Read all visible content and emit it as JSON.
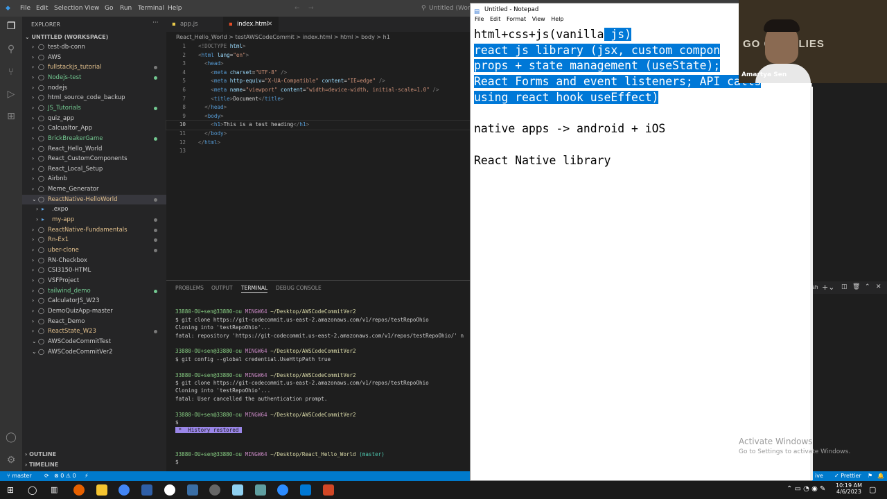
{
  "vscode": {
    "menu": [
      "File",
      "Edit",
      "Selection",
      "View",
      "Go",
      "Run",
      "Terminal",
      "Help"
    ],
    "window_title": "Untitled (Worksp",
    "explorer_title": "EXPLORER",
    "workspace_title": "UNTITLED (WORKSPACE)",
    "folders": [
      {
        "label": "test-db-conn",
        "color": "#cccccc",
        "dot": false
      },
      {
        "label": "AWS",
        "color": "#cccccc",
        "dot": false
      },
      {
        "label": "fullstackjs_tutorial",
        "color": "#e2c08d",
        "dot": true
      },
      {
        "label": "Nodejs-test",
        "color": "#73c991",
        "dot": true
      },
      {
        "label": "nodejs",
        "color": "#cccccc",
        "dot": false
      },
      {
        "label": "html_source_code_backup",
        "color": "#cccccc",
        "dot": false
      },
      {
        "label": "JS_Tutorials",
        "color": "#73c991",
        "dot": true
      },
      {
        "label": "quiz_app",
        "color": "#cccccc",
        "dot": false
      },
      {
        "label": "Calcualtor_App",
        "color": "#cccccc",
        "dot": false
      },
      {
        "label": "BrickBreakerGame",
        "color": "#73c991",
        "dot": true
      },
      {
        "label": "React_Hello_World",
        "color": "#cccccc",
        "dot": false
      },
      {
        "label": "React_CustomComponents",
        "color": "#cccccc",
        "dot": false
      },
      {
        "label": "React_Local_Setup",
        "color": "#cccccc",
        "dot": false
      },
      {
        "label": "Airbnb",
        "color": "#cccccc",
        "dot": false
      },
      {
        "label": "Meme_Generator",
        "color": "#cccccc",
        "dot": false
      },
      {
        "label": "ReactNative-HelloWorld",
        "color": "#e2c08d",
        "dot": true,
        "open": true,
        "selected": true
      },
      {
        "label": ".expo",
        "color": "#cccccc",
        "dot": false,
        "child": true
      },
      {
        "label": "my-app",
        "color": "#e2c08d",
        "dot": true,
        "child": true
      },
      {
        "label": "ReactNative-Fundamentals",
        "color": "#e2c08d",
        "dot": true
      },
      {
        "label": "Rn-Ex1",
        "color": "#e2c08d",
        "dot": true
      },
      {
        "label": "uber-clone",
        "color": "#e2c08d",
        "dot": true
      },
      {
        "label": "RN-Checkbox",
        "color": "#cccccc",
        "dot": false
      },
      {
        "label": "CSI3150-HTML",
        "color": "#cccccc",
        "dot": false
      },
      {
        "label": "VSFProject",
        "color": "#cccccc",
        "dot": false
      },
      {
        "label": "tailwind_demo",
        "color": "#73c991",
        "dot": true
      },
      {
        "label": "CalculatorJS_W23",
        "color": "#cccccc",
        "dot": false
      },
      {
        "label": "DemoQuizApp-master",
        "color": "#cccccc",
        "dot": false
      },
      {
        "label": "React_Demo",
        "color": "#cccccc",
        "dot": false
      },
      {
        "label": "ReactState_W23",
        "color": "#e2c08d",
        "dot": true
      },
      {
        "label": "AWSCodeCommitTest",
        "color": "#cccccc",
        "dot": false,
        "open": true
      },
      {
        "label": "AWSCodeCommitVer2",
        "color": "#cccccc",
        "dot": false,
        "open": true
      }
    ],
    "outline_label": "OUTLINE",
    "timeline_label": "TIMELINE",
    "tabs": [
      {
        "label": "app.js"
      },
      {
        "label": "index.html",
        "active": true
      }
    ],
    "breadcrumb": "React_Hello_World  >  testAWSCodeCommit  >  index.html  >  html  >  body  >  h1",
    "code_lines": [
      {
        "n": "1",
        "html": "<span style='color:#808080'>&lt;!DOCTYPE </span><span style='color:#9cdcfe'>html</span><span style='color:#808080'>&gt;</span>"
      },
      {
        "n": "2",
        "html": "<span style='color:#808080'>&lt;</span><span style='color:#569cd6'>html</span> <span style='color:#9cdcfe'>lang</span>=<span style='color:#ce9178'>\"en\"</span><span style='color:#808080'>&gt;</span>"
      },
      {
        "n": "3",
        "html": "  <span style='color:#808080'>&lt;</span><span style='color:#569cd6'>head</span><span style='color:#808080'>&gt;</span>"
      },
      {
        "n": "4",
        "html": "    <span style='color:#808080'>&lt;</span><span style='color:#569cd6'>meta</span> <span style='color:#9cdcfe'>charset</span>=<span style='color:#ce9178'>\"UTF-8\"</span> <span style='color:#808080'>/&gt;</span>"
      },
      {
        "n": "5",
        "html": "    <span style='color:#808080'>&lt;</span><span style='color:#569cd6'>meta</span> <span style='color:#9cdcfe'>http-equiv</span>=<span style='color:#ce9178'>\"X-UA-Compatible\"</span> <span style='color:#9cdcfe'>content</span>=<span style='color:#ce9178'>\"IE=edge\"</span> <span style='color:#808080'>/&gt;</span>"
      },
      {
        "n": "6",
        "html": "    <span style='color:#808080'>&lt;</span><span style='color:#569cd6'>meta</span> <span style='color:#9cdcfe'>name</span>=<span style='color:#ce9178'>\"viewport\"</span> <span style='color:#9cdcfe'>content</span>=<span style='color:#ce9178'>\"width=device-width, initial-scale=1.0\"</span> <span style='color:#808080'>/&gt;</span>"
      },
      {
        "n": "7",
        "html": "    <span style='color:#808080'>&lt;</span><span style='color:#569cd6'>title</span><span style='color:#808080'>&gt;</span>Document<span style='color:#808080'>&lt;/</span><span style='color:#569cd6'>title</span><span style='color:#808080'>&gt;</span>"
      },
      {
        "n": "8",
        "html": "  <span style='color:#808080'>&lt;/</span><span style='color:#569cd6'>head</span><span style='color:#808080'>&gt;</span>"
      },
      {
        "n": "9",
        "html": "  <span style='color:#808080'>&lt;</span><span style='color:#569cd6'>body</span><span style='color:#808080'>&gt;</span>"
      },
      {
        "n": "10",
        "html": "    <span style='color:#808080'>&lt;</span><span style='color:#569cd6'>h1</span><span style='color:#808080'>&gt;</span>This is a test heading<span style='color:#808080'>&lt;/</span><span style='color:#569cd6'>h1</span><span style='color:#808080'>&gt;</span>",
        "current": true
      },
      {
        "n": "11",
        "html": "  <span style='color:#808080'>&lt;/</span><span style='color:#569cd6'>body</span><span style='color:#808080'>&gt;</span>"
      },
      {
        "n": "12",
        "html": "<span style='color:#808080'>&lt;/</span><span style='color:#569cd6'>html</span><span style='color:#808080'>&gt;</span>"
      },
      {
        "n": "13",
        "html": ""
      }
    ],
    "panel_tabs": [
      "PROBLEMS",
      "OUTPUT",
      "TERMINAL",
      "DEBUG CONSOLE"
    ],
    "terminal_lines": [
      {
        "html": ""
      },
      {
        "html": "<span class='g'>33880-OU+sen@33880-ou</span> <span class='p'>MINGW64</span> <span class='y'>~/Desktop/AWSCodeCommitVer2</span>"
      },
      {
        "html": "$ git clone https://git-codecommit.us-east-2.amazonaws.com/v1/repos/testRepoOhio"
      },
      {
        "html": "Cloning into 'testRepoOhio'..."
      },
      {
        "html": "fatal: repository 'https://git-codecommit.us-east-2.amazonaws.com/v1/repos/testRepoOhio/' n"
      },
      {
        "html": ""
      },
      {
        "html": "<span class='g'>33880-OU+sen@33880-ou</span> <span class='p'>MINGW64</span> <span class='y'>~/Desktop/AWSCodeCommitVer2</span>"
      },
      {
        "html": "$ git config --global credential.UseHttpPath true"
      },
      {
        "html": ""
      },
      {
        "html": "<span class='g'>33880-OU+sen@33880-ou</span> <span class='p'>MINGW64</span> <span class='y'>~/Desktop/AWSCodeCommitVer2</span>"
      },
      {
        "html": "$ git clone https://git-codecommit.us-east-2.amazonaws.com/v1/repos/testRepoOhio"
      },
      {
        "html": "Cloning into 'testRepoOhio'..."
      },
      {
        "html": "fatal: User cancelled the authentication prompt."
      },
      {
        "html": ""
      },
      {
        "html": "<span class='g'>33880-OU+sen@33880-ou</span> <span class='p'>MINGW64</span> <span class='y'>~/Desktop/AWSCodeCommitVer2</span>"
      },
      {
        "html": "$"
      },
      {
        "html": "<span style='background:#9a86e8;color:#1e1e1e'> *  History restored </span>"
      },
      {
        "html": ""
      },
      {
        "html": ""
      },
      {
        "html": "<span class='g'>33880-OU+sen@33880-ou</span> <span class='p'>MINGW64</span> <span class='y'>~/Desktop/React_Hello_World</span> <span class='c'>(master)</span>"
      },
      {
        "html": "$"
      }
    ],
    "status": {
      "branch": "master",
      "problems": "⊗ 0 ⚠ 0",
      "prettier": "✓ Prettier",
      "sh": "sh"
    }
  },
  "notepad": {
    "title": "Untitled - Notepad",
    "menu": [
      "File",
      "Edit",
      "Format",
      "View",
      "Help"
    ],
    "lines": [
      {
        "pre": "html+css+js(vanilla",
        "sel": " js)"
      },
      {
        "pre": "",
        "sel": "react js library (jsx, custom compon"
      },
      {
        "pre": "",
        "sel": "props + state management (useState);"
      },
      {
        "pre": "",
        "sel": "React Forms and event listeners; API calls"
      },
      {
        "pre": "",
        "sel": "using react hook useEffect)"
      },
      {
        "pre": "",
        "sel": ""
      },
      {
        "pre": "native apps -> android + iOS",
        "sel": ""
      },
      {
        "pre": "",
        "sel": ""
      },
      {
        "pre": "React Native library",
        "sel": ""
      }
    ]
  },
  "webcam": {
    "name": "Amartya Sen",
    "banner": "GO      GRIZZLIES"
  },
  "watermark": {
    "line1": "Activate Windows",
    "line2": "Go to Settings to activate Windows."
  },
  "taskbar": {
    "time": "10:19 AM",
    "date": "4/6/2023"
  }
}
